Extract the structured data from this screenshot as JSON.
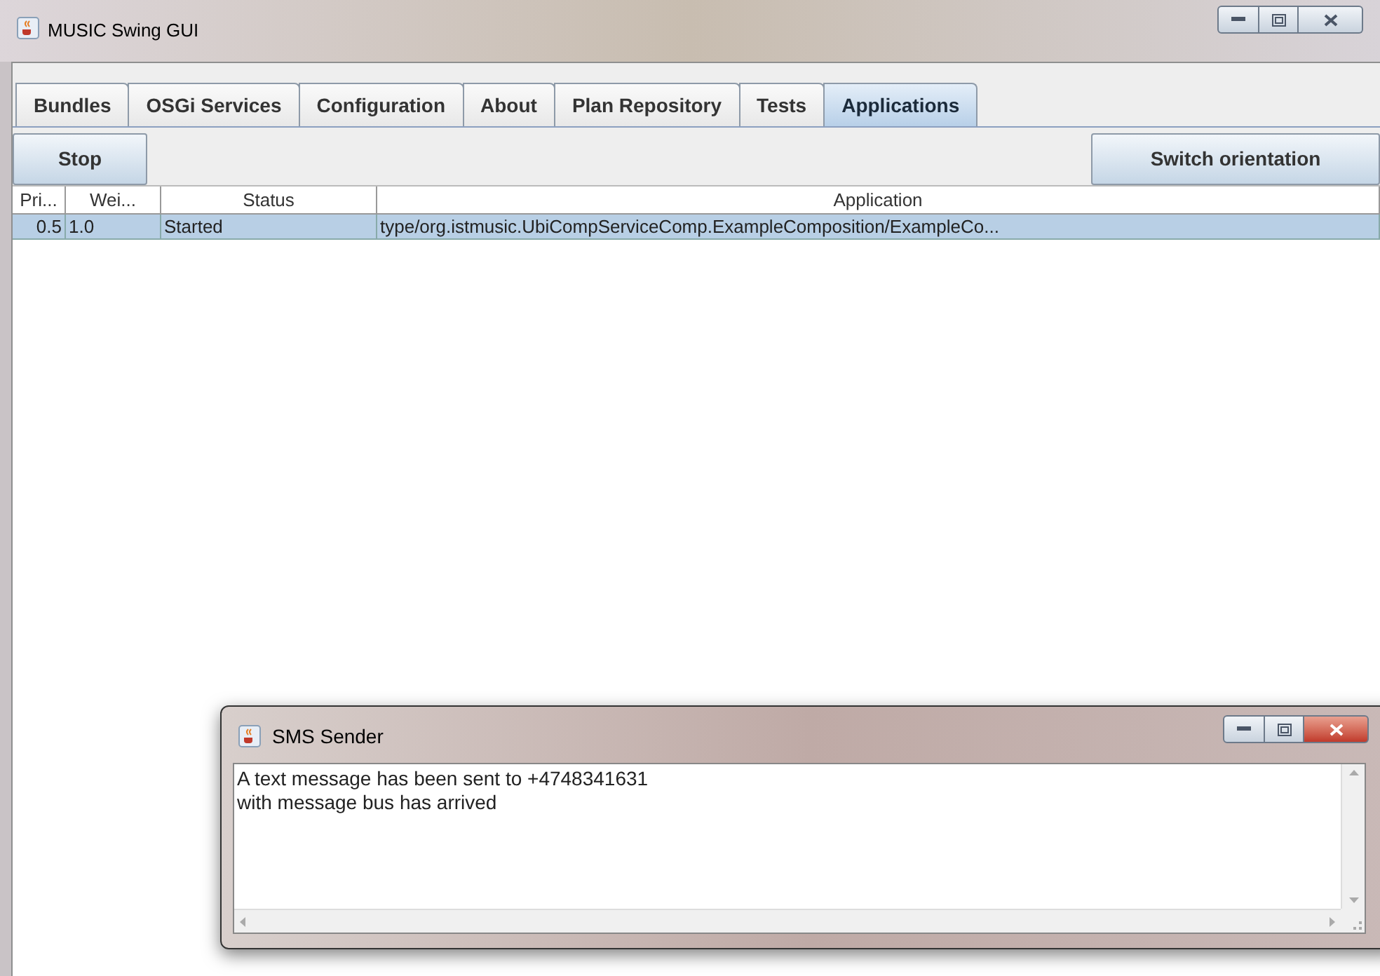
{
  "window": {
    "title": "MUSIC Swing GUI"
  },
  "tabs": [
    {
      "label": "Bundles",
      "selected": false
    },
    {
      "label": "OSGi Services",
      "selected": false
    },
    {
      "label": "Configuration",
      "selected": false
    },
    {
      "label": "About",
      "selected": false
    },
    {
      "label": "Plan Repository",
      "selected": false
    },
    {
      "label": "Tests",
      "selected": false
    },
    {
      "label": "Applications",
      "selected": true
    }
  ],
  "toolbar": {
    "left_button": "Stop",
    "right_button": "Switch orientation"
  },
  "table": {
    "columns": [
      "Pri...",
      "Wei...",
      "Status",
      "Application"
    ],
    "rows": [
      {
        "cells": [
          "0.5",
          "1.0",
          "Started",
          "type/org.istmusic.UbiCompServiceComp.ExampleComposition/ExampleCo..."
        ],
        "selected": true
      }
    ]
  },
  "dialog": {
    "title": "SMS Sender",
    "lines": [
      "A text message has been sent to +4748341631",
      "with message bus has arrived"
    ]
  }
}
